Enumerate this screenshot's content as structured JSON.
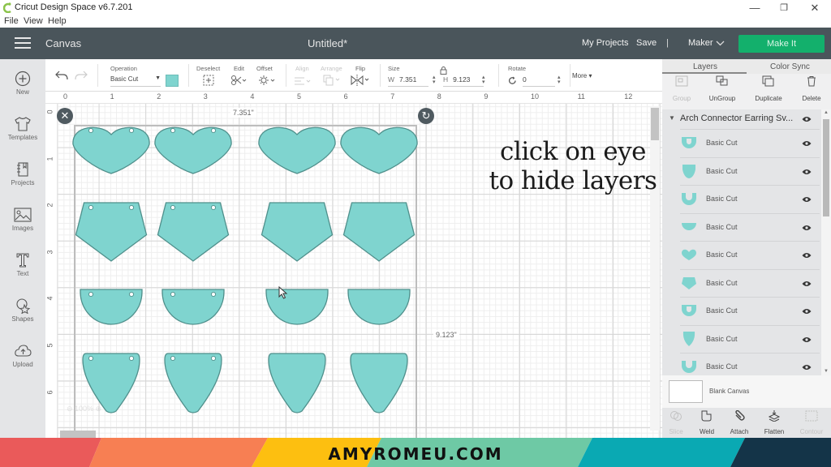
{
  "window": {
    "app_title": "Cricut Design Space  v6.7.201",
    "minimize_glyph": "—",
    "restore_glyph": "❐",
    "close_glyph": "✕"
  },
  "menubar": {
    "items": [
      "File",
      "View",
      "Help"
    ]
  },
  "header": {
    "section_title": "Canvas",
    "document_title": "Untitled*",
    "my_projects": "My Projects",
    "save": "Save",
    "separator": "|",
    "machine": "Maker",
    "make_it": "Make It",
    "make_it_color": "#13b06c"
  },
  "left_sidebar": {
    "items": [
      {
        "label": "New",
        "icon": "plus-circle-icon"
      },
      {
        "label": "Templates",
        "icon": "tshirt-icon"
      },
      {
        "label": "Projects",
        "icon": "notebook-icon"
      },
      {
        "label": "Images",
        "icon": "image-icon"
      },
      {
        "label": "Text",
        "icon": "text-t-icon"
      },
      {
        "label": "Shapes",
        "icon": "shapes-icon"
      },
      {
        "label": "Upload",
        "icon": "cloud-upload-icon"
      }
    ]
  },
  "toolbar": {
    "operation_label": "Operation",
    "operation_value": "Basic Cut",
    "operation_color": "#7fd4cf",
    "deselect_label": "Deselect",
    "edit_label": "Edit",
    "offset_label": "Offset",
    "align_label": "Align",
    "arrange_label": "Arrange",
    "flip_label": "Flip",
    "size_label": "Size",
    "width_prefix": "W",
    "width_value": "7.351",
    "height_prefix": "H",
    "height_value": "9.123",
    "rotate_label": "Rotate",
    "rotate_value": "0",
    "more_label": "More ▾"
  },
  "canvas": {
    "ruler_top": [
      "0",
      "1",
      "2",
      "3",
      "4",
      "5",
      "6",
      "7",
      "8",
      "9",
      "10",
      "11",
      "12"
    ],
    "ruler_left": [
      "0",
      "1",
      "2",
      "3",
      "4",
      "5",
      "6"
    ],
    "selection_width": "7.351\"",
    "selection_height": "9.123\"",
    "zoom_level": "100%",
    "shape_fill": "#7fd4cf",
    "shape_stroke": "#4f8f8b",
    "annotation_line1": "click on eye",
    "annotation_line2": "to hide layers",
    "arrow_color": "#e8141a"
  },
  "layers_panel": {
    "tabs": [
      "Layers",
      "Color Sync"
    ],
    "actions": [
      {
        "label": "Group",
        "enabled": false
      },
      {
        "label": "UnGroup",
        "enabled": true
      },
      {
        "label": "Duplicate",
        "enabled": true
      },
      {
        "label": "Delete",
        "enabled": true
      }
    ],
    "group_name": "Arch Connector Earring Sv...",
    "layers": [
      {
        "name": "Basic Cut",
        "shape": "arch-cup"
      },
      {
        "name": "Basic Cut",
        "shape": "shield-small"
      },
      {
        "name": "Basic Cut",
        "shape": "u-arch"
      },
      {
        "name": "Basic Cut",
        "shape": "half-circle"
      },
      {
        "name": "Basic Cut",
        "shape": "heart"
      },
      {
        "name": "Basic Cut",
        "shape": "pentagon"
      },
      {
        "name": "Basic Cut",
        "shape": "arch-cup"
      },
      {
        "name": "Basic Cut",
        "shape": "shield"
      },
      {
        "name": "Basic Cut",
        "shape": "u-arch"
      }
    ],
    "blank_canvas": "Blank Canvas",
    "bottom_actions": [
      {
        "label": "Slice",
        "enabled": false
      },
      {
        "label": "Weld",
        "enabled": true
      },
      {
        "label": "Attach",
        "enabled": true
      },
      {
        "label": "Flatten",
        "enabled": true
      },
      {
        "label": "Contour",
        "enabled": false
      }
    ]
  },
  "banner": {
    "text": "AMYROMEU.COM",
    "colors": [
      "#ea5a5a",
      "#f77f53",
      "#fdbf10",
      "#6ec9a5",
      "#0aa9b3",
      "#143448"
    ]
  }
}
